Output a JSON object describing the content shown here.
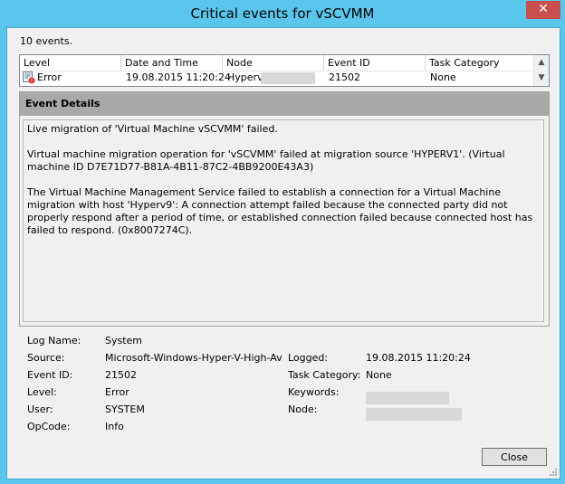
{
  "window": {
    "title": "Critical events for vSCVMM",
    "close_glyph": "✕"
  },
  "summary": {
    "count_text": "10 events."
  },
  "event_list": {
    "columns": [
      "Level",
      "Date and Time",
      "Node",
      "Event ID",
      "Task Category"
    ],
    "rows": [
      {
        "level": "Error",
        "datetime": "19.08.2015 11:20:24",
        "node": "Hyperv",
        "event_id": "21502",
        "task_category": "None"
      }
    ]
  },
  "details": {
    "header": "Event Details",
    "message": "Live migration of 'Virtual Machine vSCVMM' failed.\n\nVirtual machine migration operation for 'vSCVMM' failed at migration source 'HYPERV1'. (Virtual machine ID D7E71D77-B81A-4B11-87C2-4BB9200E43A3)\n\nThe Virtual Machine Management Service failed to establish a connection for a Virtual Machine migration with host 'Hyperv9': A connection attempt failed because the connected party did not properly respond after a period of time, or established connection failed because connected host has failed to respond. (0x8007274C)."
  },
  "properties": {
    "log_name_label": "Log Name:",
    "log_name": "System",
    "source_label": "Source:",
    "source": "Microsoft-Windows-Hyper-V-High-Avai...",
    "logged_label": "Logged:",
    "logged": "19.08.2015 11:20:24",
    "event_id_label": "Event ID:",
    "event_id": "21502",
    "task_category_label": "Task Category:",
    "task_category": "None",
    "level_label": "Level:",
    "level": "Error",
    "keywords_label": "Keywords:",
    "user_label": "User:",
    "user": "SYSTEM",
    "node_label": "Node:",
    "opcode_label": "OpCode:",
    "opcode": "Info"
  },
  "buttons": {
    "close": "Close"
  },
  "colors": {
    "titlebar": "#5bc6ec",
    "close_button": "#c7504d",
    "details_header": "#a9a9a9"
  }
}
